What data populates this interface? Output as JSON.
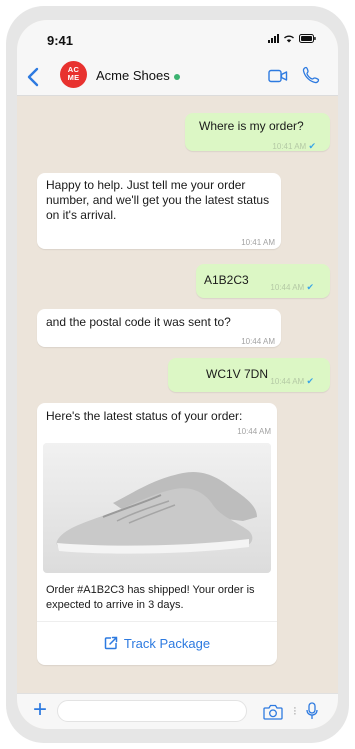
{
  "status_bar": {
    "time": "9:41"
  },
  "header": {
    "avatar_line1": "AC",
    "avatar_line2": "ME",
    "contact_name": "Acme Shoes",
    "icons": [
      "back-arrow-icon",
      "video-call-icon",
      "phone-icon"
    ]
  },
  "messages": [
    {
      "direction": "out",
      "text": "Where is my order?",
      "time": "10:41 AM"
    },
    {
      "direction": "in",
      "text": "Happy to help. Just tell me your order number, and we'll get you the latest status on it's arrival.",
      "time": "10:41 AM"
    },
    {
      "direction": "out",
      "text": "A1B2C3",
      "time": "10:44 AM"
    },
    {
      "direction": "in",
      "text": "and the postal code it was sent to?",
      "time": "10:44 AM"
    },
    {
      "direction": "out",
      "text": "WC1V 7DN",
      "time": "10:44 AM"
    },
    {
      "direction": "in",
      "text": "Here's the latest status of your order:",
      "time": "10:44 AM"
    }
  ],
  "order_card": {
    "image": "shoe-image",
    "text": "Order #A1B2C3 has shipped! Your order is expected to arrive in 3 days.",
    "button_label": "Track Package"
  },
  "input_bar": {
    "placeholder": "",
    "icons": [
      "plus-icon",
      "camera-icon",
      "microphone-icon"
    ]
  },
  "colors": {
    "accent": "#2d7ae0",
    "outgoing_bubble": "#dcf7c5",
    "incoming_bubble": "#ffffff",
    "chat_background": "#ece4da",
    "brand": "#e8322f",
    "online": "#3cb371"
  }
}
